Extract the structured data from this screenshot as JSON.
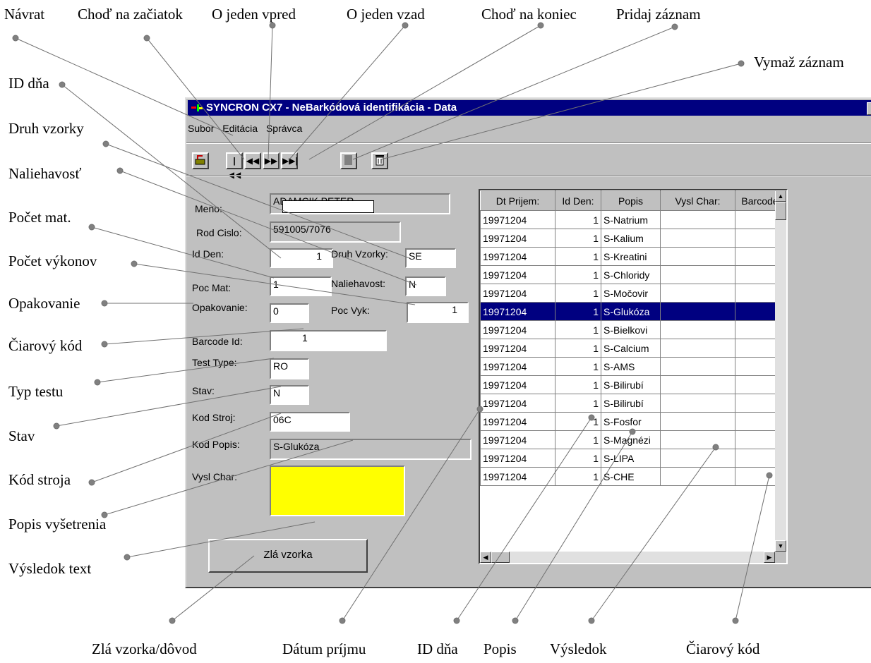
{
  "window": {
    "title": "SYNCRON CX7 - NeBarkódová identifikácia - Data",
    "menu": [
      "Subor",
      "Editácia",
      "Správca"
    ]
  },
  "annotations": {
    "navrat": "Návrat",
    "chod_zaciatok": "Choď na začiatok",
    "o_jeden_vpred": "O jeden vpred",
    "o_jeden_vzad": "O jeden vzad",
    "chod_koniec": "Choď na koniec",
    "pridaj": "Pridaj záznam",
    "vymaz": "Vymaž záznam",
    "id_dna": "ID dňa",
    "druh_vzorky": "Druh vzorky",
    "naliehavost": "Naliehavosť",
    "pocet_mat": "Počet mat.",
    "pocet_vykonov": "Počet výkonov",
    "opakovanie": "Opakovanie",
    "ciarovy_kod": "Čiarový kód",
    "typ_testu": "Typ testu",
    "stav": "Stav",
    "kod_stroja": "Kód stroja",
    "popis_vysetrenia": "Popis vyšetrenia",
    "vysledok_text": "Výsledok text",
    "zla_vzorka_dovod": "Zlá vzorka/dôvod",
    "datum_prijmu": "Dátum príjmu",
    "id_dna_bottom": "ID dňa",
    "popis": "Popis",
    "vysledok": "Výsledok",
    "ciarovy_kod_bottom": "Čiarový kód"
  },
  "form": {
    "meno_label": "Meno:",
    "meno_value": "ADAMCIK PETER",
    "rod_cislo_label": "Rod Cislo:",
    "rod_cislo_value": "591005/7076",
    "id_den_label": "Id Den:",
    "id_den_value": "1",
    "druh_vzorky_label": "Druh Vzorky:",
    "druh_vzorky_value": "SE",
    "poc_mat_label": "Poc Mat:",
    "poc_mat_value": "1",
    "naliehavost_label": "Naliehavost:",
    "naliehavost_value": "N",
    "opakovanie_label": "Opakovanie:",
    "opakovanie_value": "0",
    "poc_vyk_label": "Poc Vyk:",
    "poc_vyk_value": "1",
    "barcode_label": "Barcode Id:",
    "barcode_value": "1",
    "test_type_label": "Test Type:",
    "test_type_value": "RO",
    "stav_label": "Stav:",
    "stav_value": "N",
    "kod_stroj_label": "Kod Stroj:",
    "kod_stroj_value": "06C",
    "kod_popis_label": "Kod Popis:",
    "kod_popis_value": "S-Glukóza",
    "vysl_char_label": "Vysl Char:",
    "vysl_char_value": "",
    "bad_sample_button": "Zlá vzorka"
  },
  "table": {
    "columns": [
      "Dt Prijem:",
      "Id Den:",
      "Popis",
      "Vysl Char:",
      "Barcode"
    ],
    "rows": [
      [
        "19971204",
        "1",
        "S-Natrium",
        "",
        ""
      ],
      [
        "19971204",
        "1",
        "S-Kalium",
        "",
        ""
      ],
      [
        "19971204",
        "1",
        "S-Kreatini",
        "",
        ""
      ],
      [
        "19971204",
        "1",
        "S-Chloridy",
        "",
        ""
      ],
      [
        "19971204",
        "1",
        "S-Močovir",
        "",
        ""
      ],
      [
        "19971204",
        "1",
        "S-Glukóza",
        "",
        ""
      ],
      [
        "19971204",
        "1",
        "S-Bielkovi",
        "",
        ""
      ],
      [
        "19971204",
        "1",
        "S-Calcium",
        "",
        ""
      ],
      [
        "19971204",
        "1",
        "S-AMS",
        "",
        ""
      ],
      [
        "19971204",
        "1",
        "S-Bilirubí",
        "",
        ""
      ],
      [
        "19971204",
        "1",
        "S-Bilirubí",
        "",
        ""
      ],
      [
        "19971204",
        "1",
        "S-Fosfor",
        "",
        ""
      ],
      [
        "19971204",
        "1",
        "S-Magnézi",
        "",
        ""
      ],
      [
        "19971204",
        "1",
        "S-LIPA",
        "",
        ""
      ],
      [
        "19971204",
        "1",
        "S-CHE",
        "",
        ""
      ]
    ],
    "selected_row": 5
  }
}
